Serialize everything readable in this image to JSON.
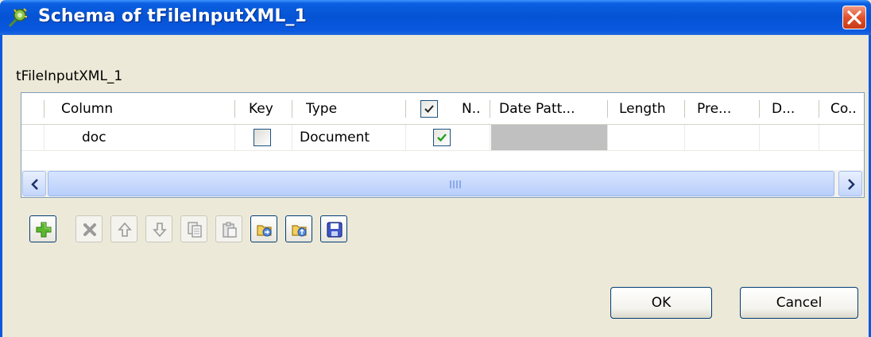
{
  "window": {
    "title": "Schema of tFileInputXML_1",
    "component_label": "tFileInputXML_1"
  },
  "table": {
    "headers": {
      "column": "Column",
      "key": "Key",
      "type": "Type",
      "nullable": "N..",
      "date_pattern": "Date Patt...",
      "length": "Length",
      "precision": "Pre...",
      "default": "D...",
      "comment": "Co.."
    },
    "rows": [
      {
        "column": "doc",
        "key": false,
        "type": "Document",
        "nullable": true,
        "date_pattern": "",
        "length": "",
        "precision": "",
        "default": "",
        "comment": ""
      }
    ]
  },
  "toolbar": {
    "buttons": [
      {
        "name": "add-button",
        "icon": "plus-icon",
        "enabled": true
      },
      {
        "name": "remove-button",
        "icon": "x-icon",
        "enabled": false
      },
      {
        "name": "move-up-button",
        "icon": "arrow-up-icon",
        "enabled": false
      },
      {
        "name": "move-down-button",
        "icon": "arrow-down-icon",
        "enabled": false
      },
      {
        "name": "copy-button",
        "icon": "copy-icon",
        "enabled": false
      },
      {
        "name": "paste-button",
        "icon": "paste-icon",
        "enabled": false
      },
      {
        "name": "import-button",
        "icon": "import-folder-icon",
        "enabled": true
      },
      {
        "name": "export-button",
        "icon": "export-folder-icon",
        "enabled": true
      },
      {
        "name": "save-button",
        "icon": "save-icon",
        "enabled": true
      }
    ]
  },
  "buttons": {
    "ok": "OK",
    "cancel": "Cancel"
  },
  "colors": {
    "titlebar": "#0553d5",
    "close_button": "#e2512c",
    "dialog_bg": "#ece9d8",
    "check_green": "#21a121"
  }
}
